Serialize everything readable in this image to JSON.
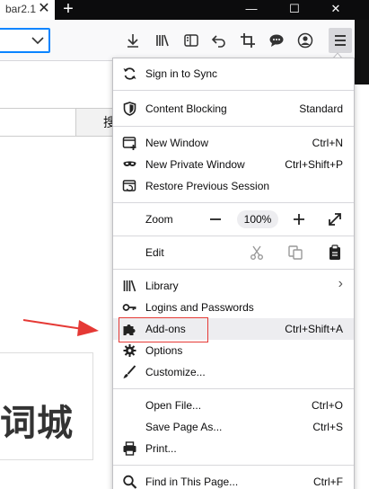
{
  "tab": {
    "title": "bar2.1",
    "close": "✕"
  },
  "window": {
    "new_tab": "+",
    "minimize": "—",
    "maximize": "☐",
    "close": "✕"
  },
  "page": {
    "search_button": "搜",
    "card_text": "词城"
  },
  "menu": {
    "sync": {
      "label": "Sign in to Sync"
    },
    "content_blocking": {
      "label": "Content Blocking",
      "value": "Standard"
    },
    "new_window": {
      "label": "New Window",
      "shortcut": "Ctrl+N"
    },
    "new_private_window": {
      "label": "New Private Window",
      "shortcut": "Ctrl+Shift+P"
    },
    "restore_session": {
      "label": "Restore Previous Session"
    },
    "zoom": {
      "label": "Zoom",
      "value": "100%",
      "minus": "−",
      "plus": "+"
    },
    "edit": {
      "label": "Edit"
    },
    "library": {
      "label": "Library",
      "chevron": "›"
    },
    "logins": {
      "label": "Logins and Passwords"
    },
    "addons": {
      "label": "Add-ons",
      "shortcut": "Ctrl+Shift+A"
    },
    "options": {
      "label": "Options"
    },
    "customize": {
      "label": "Customize..."
    },
    "open_file": {
      "label": "Open File...",
      "shortcut": "Ctrl+O"
    },
    "save_page": {
      "label": "Save Page As...",
      "shortcut": "Ctrl+S"
    },
    "print": {
      "label": "Print..."
    },
    "find": {
      "label": "Find in This Page...",
      "shortcut": "Ctrl+F"
    }
  },
  "colors": {
    "highlight_box": "#e53935",
    "arrow": "#e53935",
    "hover": "#ededf0"
  }
}
